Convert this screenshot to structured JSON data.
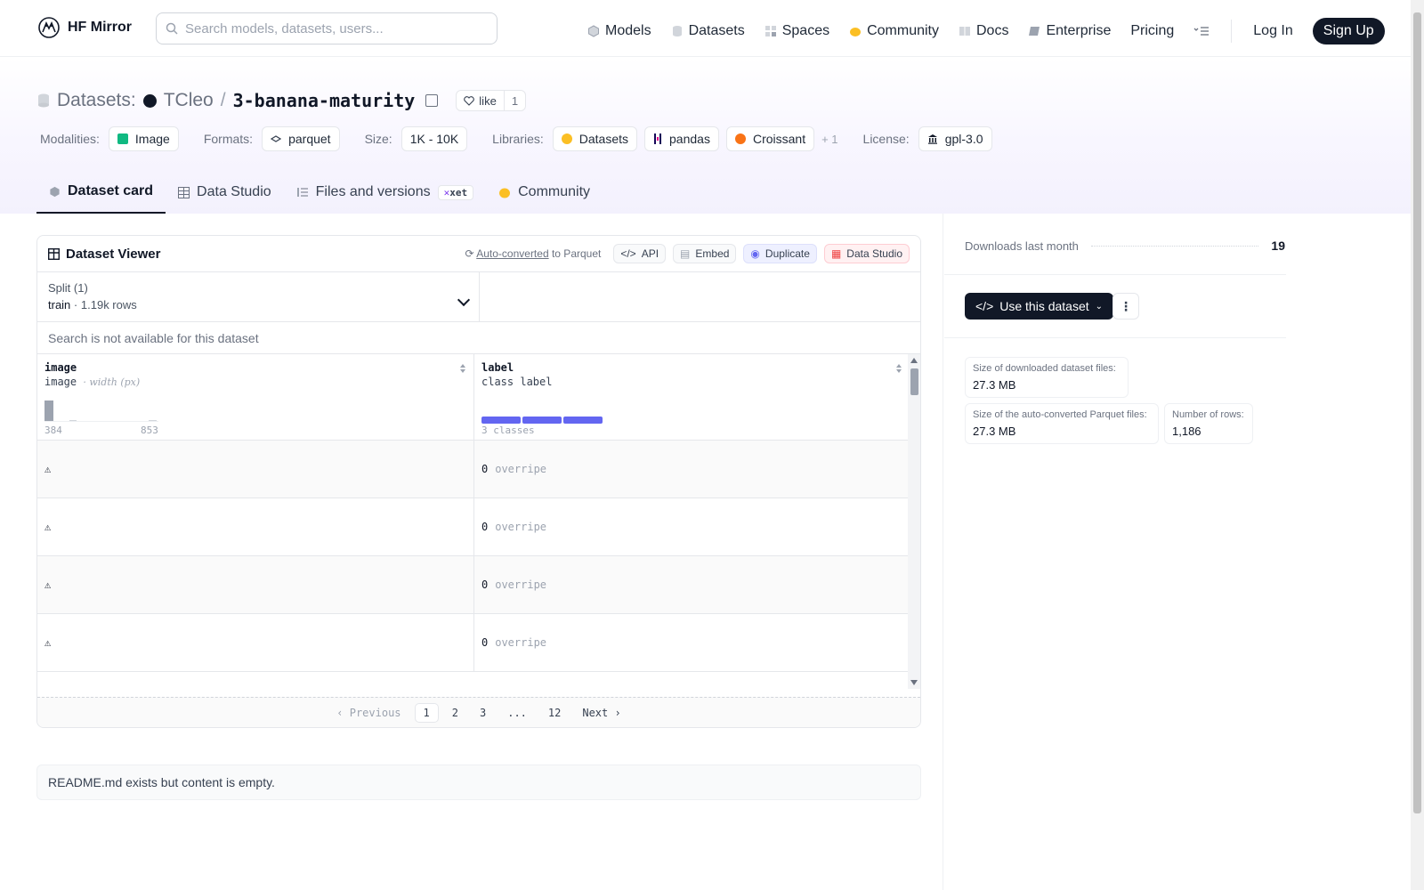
{
  "header": {
    "brand": "HF Mirror",
    "search_placeholder": "Search models, datasets, users...",
    "nav": [
      {
        "label": "Models",
        "icon": "cube-icon"
      },
      {
        "label": "Datasets",
        "icon": "database-icon"
      },
      {
        "label": "Spaces",
        "icon": "grid-icon"
      },
      {
        "label": "Community",
        "icon": "hand-icon"
      },
      {
        "label": "Docs",
        "icon": "book-icon"
      },
      {
        "label": "Enterprise",
        "icon": "briefcase-icon"
      },
      {
        "label": "Pricing",
        "icon": ""
      }
    ],
    "login": "Log In",
    "signup": "Sign Up"
  },
  "dataset": {
    "section": "Datasets:",
    "owner": "TCleo",
    "separator": "/",
    "name": "3-banana-maturity",
    "like_label": "like",
    "like_count": "1"
  },
  "meta": {
    "modalities_label": "Modalities:",
    "modalities": "Image",
    "formats_label": "Formats:",
    "formats": "parquet",
    "size_label": "Size:",
    "size": "1K - 10K",
    "libraries_label": "Libraries:",
    "libraries": [
      "Datasets",
      "pandas",
      "Croissant"
    ],
    "libraries_more": "+ 1",
    "license_label": "License:",
    "license": "gpl-3.0"
  },
  "tabs": [
    {
      "label": "Dataset card",
      "active": true
    },
    {
      "label": "Data Studio",
      "active": false
    },
    {
      "label": "Files and versions",
      "active": false,
      "badge": "xet"
    },
    {
      "label": "Community",
      "active": false
    }
  ],
  "viewer": {
    "title": "Dataset Viewer",
    "auto_link": "Auto-converted",
    "auto_rest": "to Parquet",
    "actions": [
      "API",
      "Embed",
      "Duplicate",
      "Data Studio"
    ],
    "split_title": "Split (1)",
    "split_name": "train",
    "split_dot": "·",
    "split_rows": "1.19k rows",
    "search_msg": "Search is not available for this dataset",
    "columns": [
      {
        "name": "image",
        "type": "image",
        "type_note": "· width (px)",
        "axis_min": "384",
        "axis_max": "853"
      },
      {
        "name": "label",
        "type": "class label",
        "axis_note": "3 classes"
      }
    ],
    "rows": [
      {
        "label_id": "0",
        "label_name": "overripe"
      },
      {
        "label_id": "0",
        "label_name": "overripe"
      },
      {
        "label_id": "0",
        "label_name": "overripe"
      },
      {
        "label_id": "0",
        "label_name": "overripe"
      }
    ],
    "pager": {
      "prev": "Previous",
      "pages": [
        "1",
        "2",
        "3",
        "...",
        "12"
      ],
      "next": "Next",
      "current": "1"
    }
  },
  "readme_msg": "README.md exists but content is empty.",
  "sidebar": {
    "downloads_label": "Downloads last month",
    "downloads": "19",
    "use_button": "Use this dataset",
    "stats": [
      {
        "label": "Size of downloaded dataset files:",
        "value": "27.3 MB"
      },
      {
        "label": "Size of the auto-converted Parquet files:",
        "value": "27.3 MB"
      },
      {
        "label": "Number of rows:",
        "value": "1,186"
      }
    ]
  },
  "colors": {
    "accent": "#6366f1",
    "dark": "#111827"
  }
}
